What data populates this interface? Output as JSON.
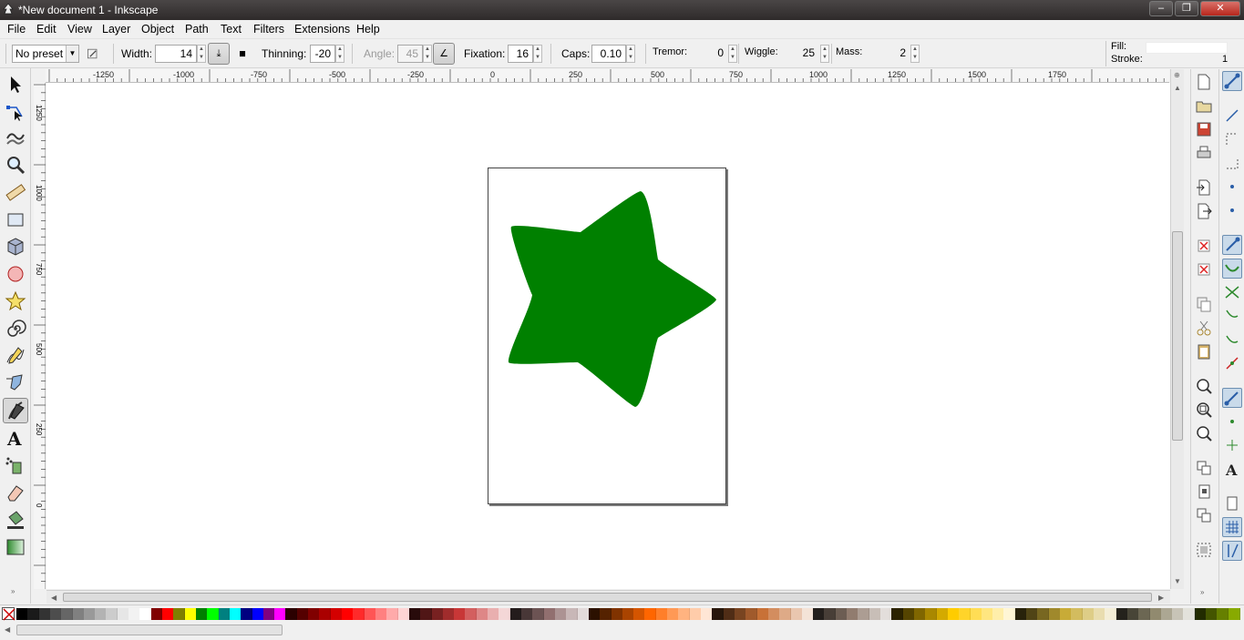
{
  "window": {
    "title": "*New document 1 - Inkscape",
    "minimize": "–",
    "maximize": "❐",
    "close": "✕"
  },
  "menubar": [
    {
      "id": "file",
      "label": "File"
    },
    {
      "id": "edit",
      "label": "Edit"
    },
    {
      "id": "view",
      "label": "View"
    },
    {
      "id": "layer",
      "label": "Layer"
    },
    {
      "id": "object",
      "label": "Object"
    },
    {
      "id": "path",
      "label": "Path"
    },
    {
      "id": "text",
      "label": "Text"
    },
    {
      "id": "filters",
      "label": "Filters"
    },
    {
      "id": "extensions",
      "label": "Extensions"
    },
    {
      "id": "help",
      "label": "Help"
    }
  ],
  "tool_controls": {
    "preset": "No preset",
    "width_label": "Width:",
    "width_value": "14",
    "thinning_label": "Thinning:",
    "thinning_value": "-20",
    "angle_label": "Angle:",
    "angle_value": "45",
    "fixation_label": "Fixation:",
    "fixation_value": "16",
    "caps_label": "Caps:",
    "caps_value": "0.10",
    "tremor_label": "Tremor:",
    "tremor_value": "0",
    "wiggle_label": "Wiggle:",
    "wiggle_value": "25",
    "mass_label": "Mass:",
    "mass_value": "2"
  },
  "fill_stroke": {
    "fill_label": "Fill:",
    "stroke_label": "Stroke:",
    "stroke_width": "1"
  },
  "ruler": {
    "h_ticks": [
      "-1250",
      "-1000",
      "-750",
      "-500",
      "-250",
      "0",
      "250",
      "500",
      "750",
      "1000",
      "1250",
      "1500",
      "1750"
    ],
    "v_ticks": [
      "1250",
      "1000",
      "750",
      "500",
      "250",
      "0"
    ]
  },
  "canvas": {
    "star_fill": "#008000",
    "page_border": "#444444"
  },
  "colors": {
    "titlebar": "#3b3737",
    "accent_snap": "#c9daea",
    "close_button": "#c9463d"
  },
  "palette": [
    "#000000",
    "#1a1a1a",
    "#333333",
    "#4d4d4d",
    "#666666",
    "#808080",
    "#999999",
    "#b3b3b3",
    "#cccccc",
    "#e6e6e6",
    "#f2f2f2",
    "#ffffff",
    "#800000",
    "#ff0000",
    "#808000",
    "#ffff00",
    "#008000",
    "#00ff00",
    "#008080",
    "#00ffff",
    "#000080",
    "#0000ff",
    "#800080",
    "#ff00ff",
    "#2b0000",
    "#550000",
    "#800000",
    "#aa0000",
    "#d40000",
    "#ff0000",
    "#ff2a2a",
    "#ff5555",
    "#ff8080",
    "#ffaaaa",
    "#ffd5d5",
    "#280b0b",
    "#501616",
    "#782121",
    "#a02c2c",
    "#c83737",
    "#d35f5f",
    "#de8787",
    "#e9afaf",
    "#f4d7d7",
    "#241c1c",
    "#483737",
    "#6c5353",
    "#916f6f",
    "#ac9393",
    "#c8b7b7",
    "#e3dbdb",
    "#2b1100",
    "#552200",
    "#803300",
    "#aa4400",
    "#d45500",
    "#ff6600",
    "#ff7f2a",
    "#ff9955",
    "#ffb380",
    "#ffccaa",
    "#ffe6d5",
    "#28170b",
    "#502d16",
    "#784421",
    "#a05a2c",
    "#c87137",
    "#d38d5f",
    "#deaa87",
    "#e9c6af",
    "#f4e3d7",
    "#241f1c",
    "#483e37",
    "#6c5d53",
    "#917c6f",
    "#ac9d93",
    "#c8beb7",
    "#e3dedb",
    "#2b2200",
    "#554400",
    "#806600",
    "#aa8800",
    "#d4aa00",
    "#ffcc00",
    "#ffd42a",
    "#ffdd55",
    "#ffe680",
    "#ffeeaa",
    "#fff6d5",
    "#28220b",
    "#504416",
    "#786721",
    "#a0892c",
    "#c8ab37",
    "#d3bc5f",
    "#decd87",
    "#e9ddaf",
    "#f4eed7",
    "#24221c",
    "#484537",
    "#6c6753",
    "#918a6f",
    "#aca793",
    "#c8c4b7",
    "#e3e2db",
    "#222b00",
    "#445500",
    "#668000",
    "#88aa00"
  ]
}
